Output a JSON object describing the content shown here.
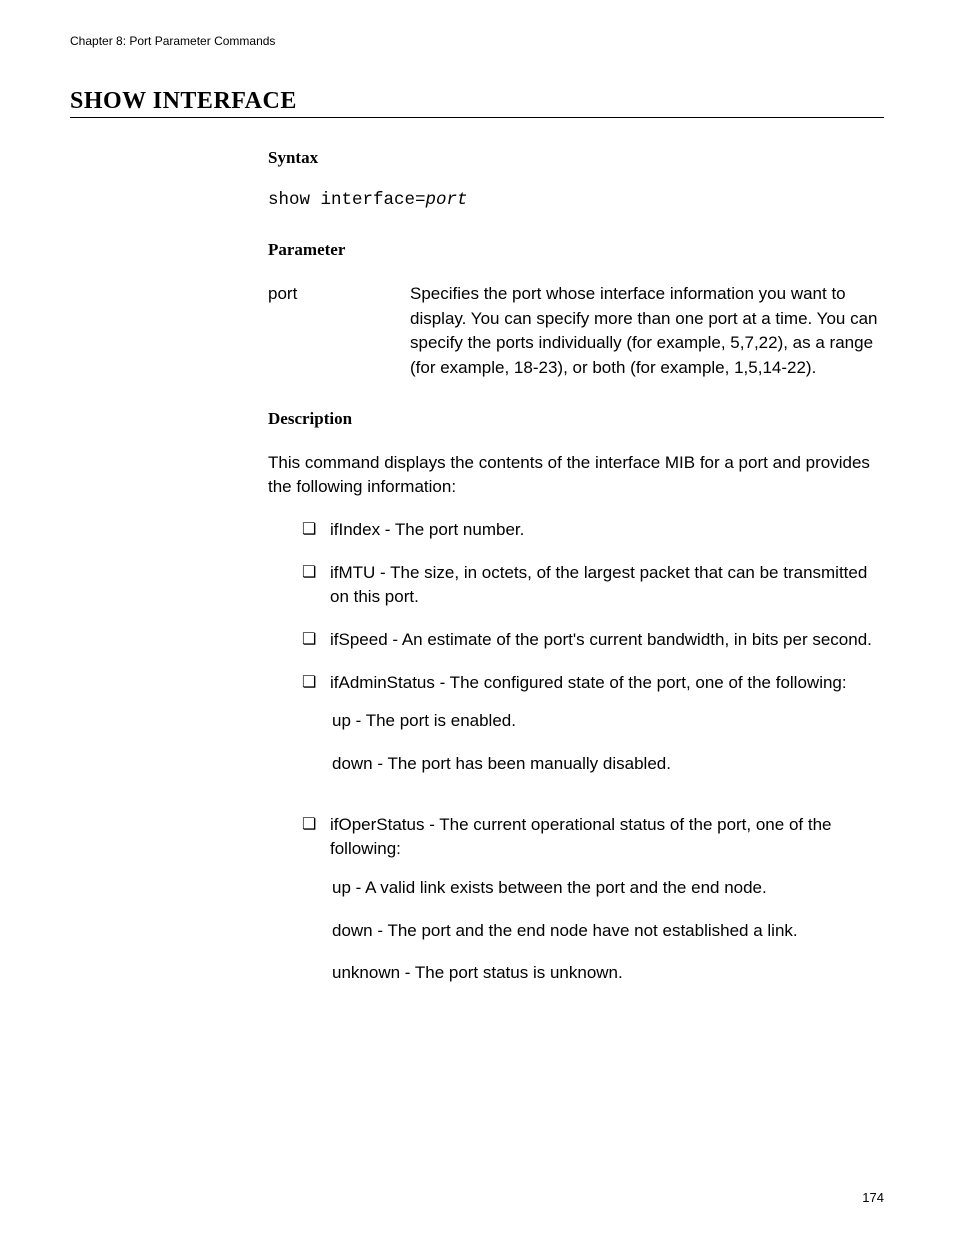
{
  "header": "Chapter 8: Port Parameter Commands",
  "title": "SHOW INTERFACE",
  "sections": {
    "syntax": {
      "heading": "Syntax",
      "cmd_prefix": "show interface=",
      "cmd_param": "port"
    },
    "parameter": {
      "heading": "Parameter",
      "name": "port",
      "desc": "Specifies the port whose interface information you want to display. You can specify more than one port at a time. You can specify the ports individually (for example, 5,7,22), as a range (for example, 18-23), or both (for example, 1,5,14-22)."
    },
    "description": {
      "heading": "Description",
      "intro": "This command displays the contents of the interface MIB for a port and provides the following information:",
      "items": [
        {
          "text": "ifIndex - The port number."
        },
        {
          "text": "ifMTU - The size, in octets, of the largest packet that can be transmitted on this port."
        },
        {
          "text": "ifSpeed - An estimate of the port's current bandwidth, in bits per second."
        },
        {
          "text": "ifAdminStatus - The configured state of the port, one of the following:",
          "sub": [
            "up - The port is enabled.",
            "down - The port has been manually disabled."
          ]
        },
        {
          "text": "ifOperStatus - The current operational status of the port, one of the following:",
          "sub": [
            "up - A valid link exists between the port and the end node.",
            "down - The port and the end node have not established a link.",
            "unknown - The port status is unknown."
          ]
        }
      ]
    }
  },
  "pageNumber": "174"
}
